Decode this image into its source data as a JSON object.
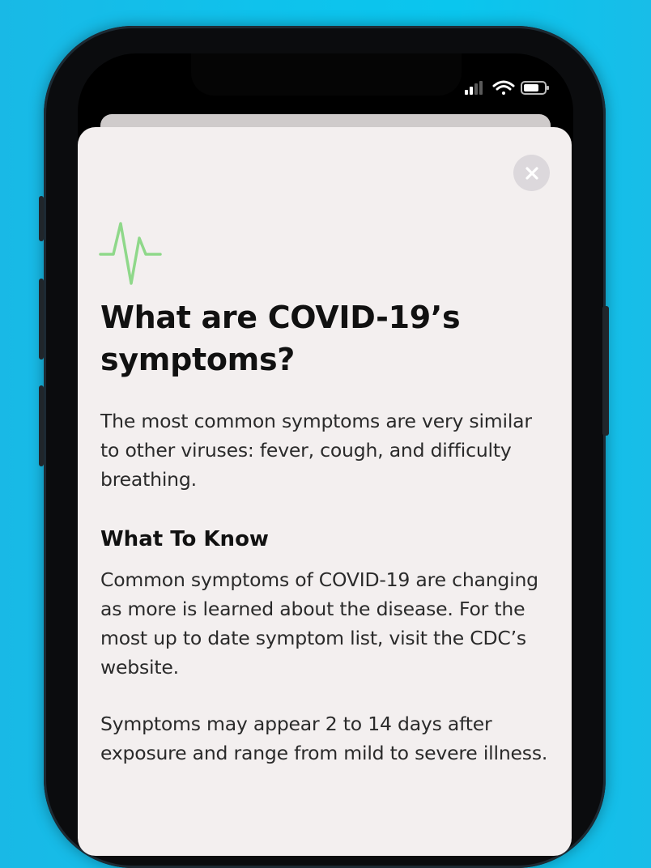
{
  "article": {
    "title": "What are COVID-19’s symptoms?",
    "intro": "The most common symptoms are very similar to other viruses: fever, cough, and difficulty breathing.",
    "section_heading": "What To Know",
    "section_para_1": "Common symptoms of COVID-19 are changing as more is learned about the disease. For the most up to date symptom list, visit the CDC’s website.",
    "section_para_2": "Symptoms may appear 2 to 14 days after exposure and range from mild to severe illness."
  },
  "icons": {
    "header_icon": "heartbeat-icon",
    "close": "close-icon",
    "status": [
      "cellular-signal-icon",
      "wifi-icon",
      "battery-icon"
    ]
  },
  "colors": {
    "background": "#0ac6ee",
    "card": "#f3efef",
    "accent_heartbeat": "#8fd88a"
  }
}
